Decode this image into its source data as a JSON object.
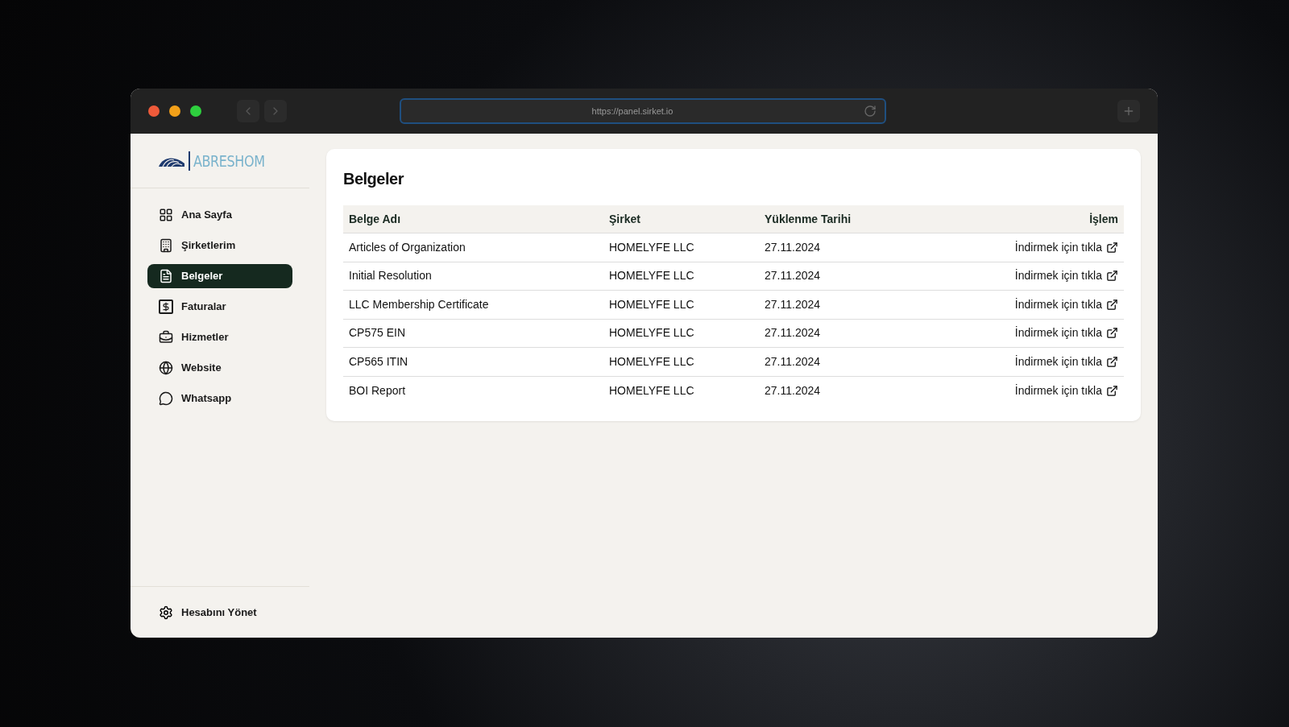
{
  "browser": {
    "url": "https://panel.sirket.io"
  },
  "logo": {
    "text": "ABRESHOM"
  },
  "sidebar": {
    "items": [
      {
        "label": "Ana Sayfa",
        "selected": false
      },
      {
        "label": "Şirketlerim",
        "selected": false
      },
      {
        "label": "Belgeler",
        "selected": true
      },
      {
        "label": "Faturalar",
        "selected": false
      },
      {
        "label": "Hizmetler",
        "selected": false
      },
      {
        "label": "Website",
        "selected": false
      },
      {
        "label": "Whatsapp",
        "selected": false
      }
    ],
    "footer": {
      "label": "Hesabını Yönet"
    }
  },
  "page": {
    "title": "Belgeler"
  },
  "table": {
    "columns": [
      "Belge Adı",
      "Şirket",
      "Yüklenme Tarihi",
      "İşlem"
    ],
    "rows": [
      [
        "Articles of Organization",
        "HOMELYFE LLC",
        "27.11.2024",
        "İndirmek için tıkla"
      ],
      [
        "Initial Resolution",
        "HOMELYFE LLC",
        "27.11.2024",
        "İndirmek için tıkla"
      ],
      [
        "LLC Membership Certificate",
        "HOMELYFE LLC",
        "27.11.2024",
        "İndirmek için tıkla"
      ],
      [
        "CP575 EIN",
        "HOMELYFE LLC",
        "27.11.2024",
        "İndirmek için tıkla"
      ],
      [
        "CP565 ITIN",
        "HOMELYFE LLC",
        "27.11.2024",
        "İndirmek için tıkla"
      ],
      [
        "BOI Report",
        "HOMELYFE LLC",
        "27.11.2024",
        "İndirmek için tıkla"
      ]
    ]
  }
}
